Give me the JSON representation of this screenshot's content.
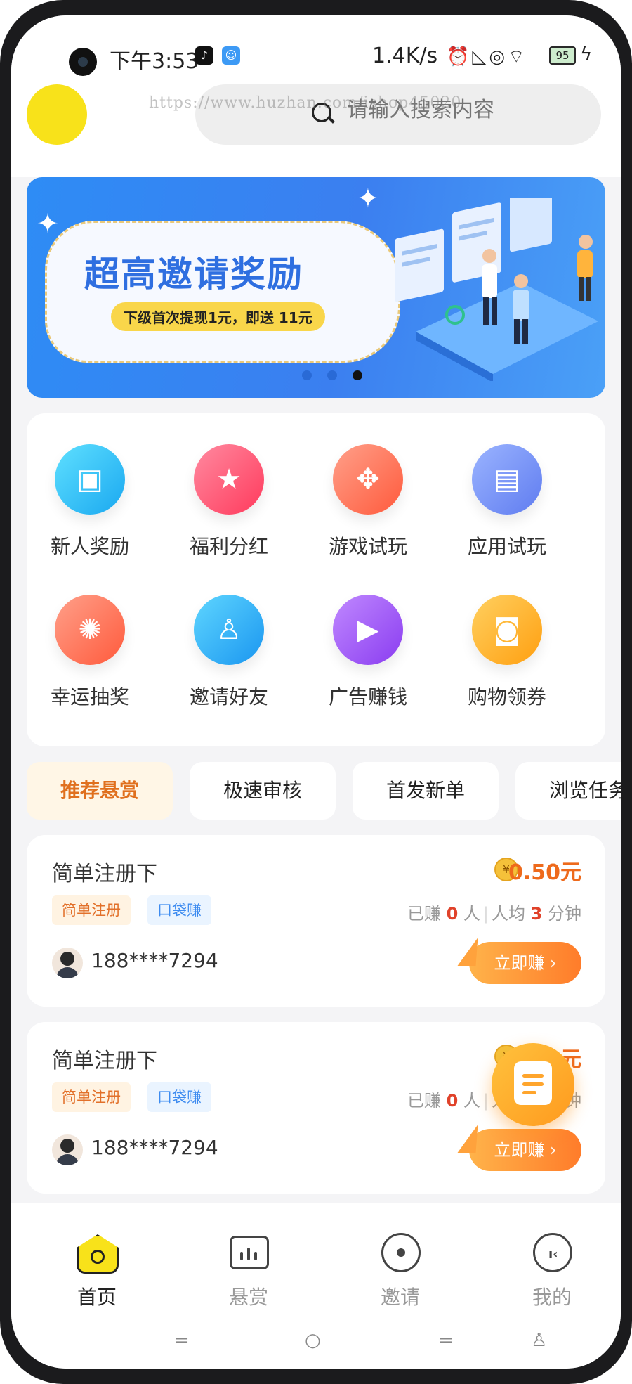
{
  "status_bar": {
    "time": "下午3:53",
    "net_speed": "1.4K/s",
    "battery": "95"
  },
  "header": {
    "search_placeholder": "请输入搜索内容",
    "watermark": "https://www.huzhan.com/ishop45020"
  },
  "banner": {
    "title": "超高邀请奖励",
    "subtitle": "下级首次提现1元，即送 11元",
    "active_dot": 3,
    "dot_count": 3
  },
  "grid": [
    {
      "label": "新人奖励",
      "icon": "new-user-reward-icon",
      "color": "#25bff0"
    },
    {
      "label": "福利分红",
      "icon": "welfare-dividend-icon",
      "color": "#ff4f6e"
    },
    {
      "label": "游戏试玩",
      "icon": "gamepad-icon",
      "color": "#ff6a4a"
    },
    {
      "label": "应用试玩",
      "icon": "app-trial-icon",
      "color": "#6c8cf5"
    },
    {
      "label": "幸运抽奖",
      "icon": "lucky-wheel-icon",
      "color": "#ff6a4a"
    },
    {
      "label": "邀请好友",
      "icon": "invite-friend-icon",
      "color": "#25b2f0"
    },
    {
      "label": "广告赚钱",
      "icon": "video-ad-icon",
      "color": "#9b4cf5"
    },
    {
      "label": "购物领券",
      "icon": "shopping-bag-icon",
      "color": "#ffad1f"
    }
  ],
  "tabs": [
    {
      "label": "推荐悬赏",
      "active": true
    },
    {
      "label": "极速审核",
      "active": false
    },
    {
      "label": "首发新单",
      "active": false
    },
    {
      "label": "浏览任务",
      "active": false
    }
  ],
  "tasks": [
    {
      "title": "简单注册下",
      "reward": "0.50元",
      "tags": [
        "简单注册",
        "口袋赚"
      ],
      "earned_prefix": "已赚",
      "earned_count": "0",
      "earned_unit": "人",
      "avg_prefix": "人均",
      "avg_minutes": "3",
      "avg_unit": "分钟",
      "user": "188****7294",
      "button": "立即赚"
    },
    {
      "title": "简单注册下",
      "reward": "0.50元",
      "tags": [
        "简单注册",
        "口袋赚"
      ],
      "earned_prefix": "已赚",
      "earned_count": "0",
      "earned_unit": "人",
      "avg_prefix": "人均",
      "avg_minutes": "3",
      "avg_unit": "分钟",
      "user": "188****7294",
      "button": "立即赚"
    }
  ],
  "bottom_nav": [
    {
      "label": "首页",
      "icon": "home-icon",
      "active": true
    },
    {
      "label": "悬赏",
      "icon": "bounty-board-icon",
      "active": false
    },
    {
      "label": "邀请",
      "icon": "invite-icon",
      "active": false
    },
    {
      "label": "我的",
      "icon": "profile-icon",
      "active": false
    }
  ]
}
